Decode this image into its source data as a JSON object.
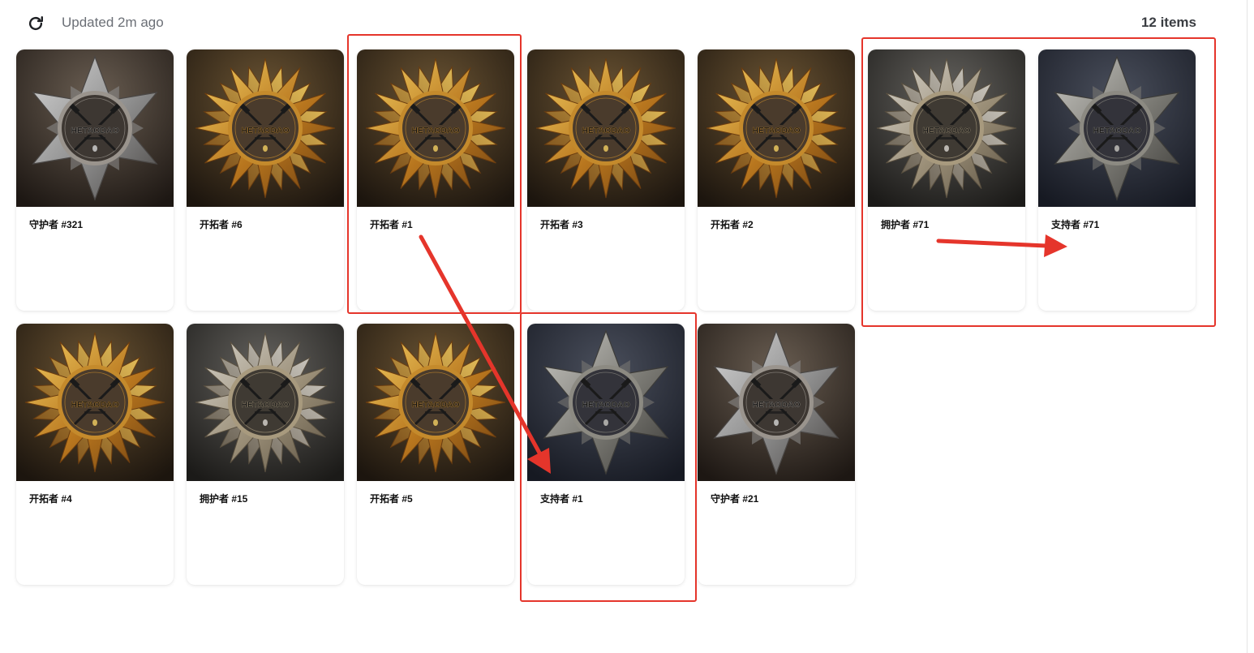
{
  "toolbar": {
    "updated_label": "Updated 2m ago",
    "items_count": "12 items",
    "refresh_icon": "refresh-icon"
  },
  "badge_text": "HETAODAO",
  "palettes": {
    "gold": {
      "bg1": "#6b5433",
      "bg2": "#1c150e",
      "r1": "#f3cf63",
      "r2": "#b8761e",
      "r3": "#6b3d10",
      "disc": "#4a3b2c",
      "rim": "#c48a2c"
    },
    "silver_gold": {
      "bg1": "#65635f",
      "bg2": "#1b1a18",
      "r1": "#d9d6cf",
      "r2": "#9b8f78",
      "r3": "#5a5040",
      "disc": "#3f3a33",
      "rim": "#a89a7e"
    },
    "steel_blue": {
      "bg1": "#4a4f5c",
      "bg2": "#161922",
      "r1": "#c7c6c1",
      "r2": "#7b7a74",
      "r3": "#3d3c39",
      "disc": "#33333a",
      "rim": "#8c8a82"
    },
    "steel_brown": {
      "bg1": "#6a5e52",
      "bg2": "#1d1713",
      "r1": "#d4d4d4",
      "r2": "#8e8e8e",
      "r3": "#4a4745",
      "disc": "#3d3732",
      "rim": "#9a948d"
    }
  },
  "cards": [
    {
      "title": "守护者 #321",
      "style": "steel_brown",
      "shape": "six"
    },
    {
      "title": "开拓者 #6",
      "style": "gold",
      "shape": "sun"
    },
    {
      "title": "开拓者 #1",
      "style": "gold",
      "shape": "sun"
    },
    {
      "title": "开拓者 #3",
      "style": "gold",
      "shape": "sun"
    },
    {
      "title": "开拓者 #2",
      "style": "gold",
      "shape": "sun"
    },
    {
      "title": "拥护者 #71",
      "style": "silver_gold",
      "shape": "sun"
    },
    {
      "title": "支持者 #71",
      "style": "steel_blue",
      "shape": "six"
    },
    {
      "title": "开拓者 #4",
      "style": "gold",
      "shape": "sun"
    },
    {
      "title": "拥护者 #15",
      "style": "silver_gold",
      "shape": "sun"
    },
    {
      "title": "开拓者 #5",
      "style": "gold",
      "shape": "sun"
    },
    {
      "title": "支持者 #1",
      "style": "steel_blue",
      "shape": "six"
    },
    {
      "title": "守护者 #21",
      "style": "steel_brown",
      "shape": "six"
    }
  ],
  "annotations": {
    "color": "#e5352b"
  }
}
